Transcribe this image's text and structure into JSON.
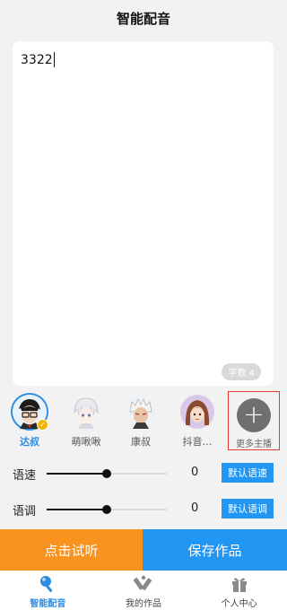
{
  "header": {
    "title": "智能配音"
  },
  "editor": {
    "text": "3322",
    "count_label": "字数 4"
  },
  "voices": [
    {
      "name": "达叔",
      "selected": true,
      "icon": "avatar-dashu"
    },
    {
      "name": "萌啾啾",
      "selected": false,
      "icon": "avatar-mengjiujiu"
    },
    {
      "name": "康叔",
      "selected": false,
      "icon": "avatar-kangshu"
    },
    {
      "name": "抖音…",
      "selected": false,
      "icon": "avatar-douyin"
    }
  ],
  "more_voices": {
    "label": "更多主播",
    "icon": "plus-icon"
  },
  "speed": {
    "label": "语速",
    "value": "0",
    "level": 0.5,
    "button": "默认语速"
  },
  "pitch": {
    "label": "语调",
    "value": "0",
    "level": 0.5,
    "button": "默认语调"
  },
  "actions": {
    "preview": "点击试听",
    "save": "保存作品"
  },
  "tabs": [
    {
      "label": "智能配音",
      "active": true,
      "icon": "smart-dub-icon"
    },
    {
      "label": "我的作品",
      "active": false,
      "icon": "my-works-icon"
    },
    {
      "label": "个人中心",
      "active": false,
      "icon": "gift-icon"
    }
  ],
  "colors": {
    "accent": "#2196f3",
    "preview": "#f7931e",
    "highlight_border": "#e53935"
  }
}
